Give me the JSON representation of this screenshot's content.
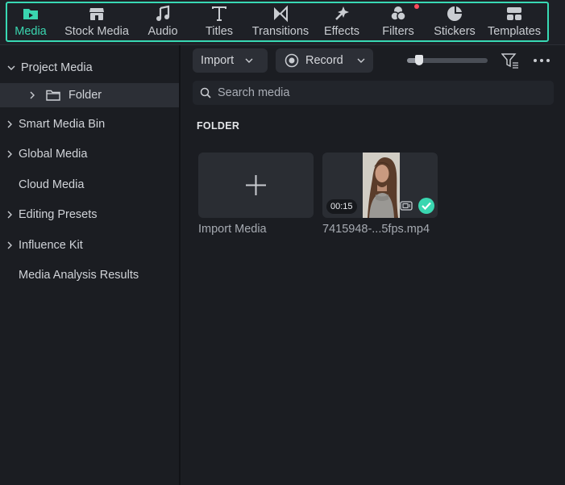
{
  "tabs": [
    {
      "label": "Media",
      "icon": "media-icon",
      "active": true
    },
    {
      "label": "Stock Media",
      "icon": "stock-media-icon"
    },
    {
      "label": "Audio",
      "icon": "music-note-icon"
    },
    {
      "label": "Titles",
      "icon": "text-icon"
    },
    {
      "label": "Transitions",
      "icon": "transitions-icon"
    },
    {
      "label": "Effects",
      "icon": "effects-icon"
    },
    {
      "label": "Filters",
      "icon": "filters-icon",
      "notification": true
    },
    {
      "label": "Stickers",
      "icon": "stickers-icon"
    },
    {
      "label": "Templates",
      "icon": "templates-icon"
    }
  ],
  "sidebar": {
    "items": [
      {
        "label": "Project Media",
        "expanded": true
      },
      {
        "label": "Folder",
        "selected": true
      },
      {
        "label": "Smart Media Bin"
      },
      {
        "label": "Global Media"
      },
      {
        "label": "Cloud Media"
      },
      {
        "label": "Editing Presets"
      },
      {
        "label": "Influence Kit"
      },
      {
        "label": "Media Analysis Results"
      }
    ]
  },
  "toolbar": {
    "import_label": "Import",
    "record_label": "Record",
    "zoom_slider_level": 0.15
  },
  "search": {
    "placeholder": "Search media"
  },
  "section_title": "FOLDER",
  "media": {
    "import_card_label": "Import Media",
    "clip": {
      "name": "7415948-...5fps.mp4",
      "duration": "00:15"
    }
  },
  "colors": {
    "accent": "#3ad6b0",
    "notification": "#ff4b5c",
    "background": "#1b1d22"
  }
}
